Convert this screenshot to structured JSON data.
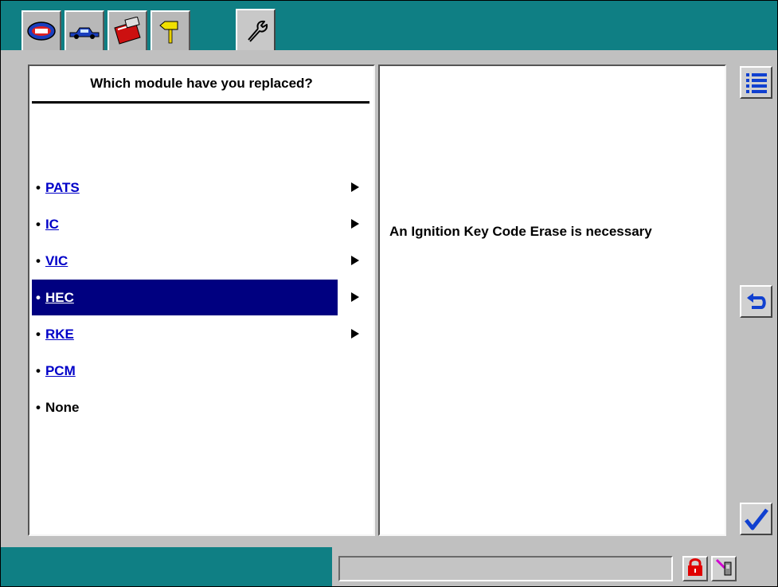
{
  "toolbar": {
    "tabs": [
      {
        "icon": "ids-logo-icon",
        "active": false
      },
      {
        "icon": "vehicle-icon",
        "active": false
      },
      {
        "icon": "toolbox-icon",
        "active": false
      },
      {
        "icon": "signpost-icon",
        "active": false
      },
      {
        "icon": "wrench-icon",
        "active": true
      }
    ]
  },
  "question": {
    "title": "Which module have you replaced?"
  },
  "options": [
    {
      "bullet": "•",
      "label": "PATS",
      "link": true,
      "has_arrow": true,
      "selected": false
    },
    {
      "bullet": "•",
      "label": "IC",
      "link": true,
      "has_arrow": true,
      "selected": false
    },
    {
      "bullet": "•",
      "label": "VIC",
      "link": true,
      "has_arrow": true,
      "selected": false
    },
    {
      "bullet": "•",
      "label": "HEC",
      "link": true,
      "has_arrow": true,
      "selected": true
    },
    {
      "bullet": "•",
      "label": "RKE",
      "link": true,
      "has_arrow": true,
      "selected": false
    },
    {
      "bullet": "•",
      "label": "PCM",
      "link": true,
      "has_arrow": false,
      "selected": false
    },
    {
      "bullet": "•",
      "label": "None",
      "link": false,
      "has_arrow": false,
      "selected": false
    }
  ],
  "info": {
    "message": "An Ignition Key Code Erase is necessary"
  },
  "side_buttons": [
    {
      "icon": "list-icon"
    },
    {
      "icon": "return-icon"
    },
    {
      "icon": "checkmark-icon"
    }
  ],
  "status": {
    "text": "",
    "icons": [
      "padlock-icon",
      "communication-icon"
    ]
  },
  "colors": {
    "frame": "#0f7f84",
    "workspace": "#c0c0c0",
    "selection": "#000080",
    "link": "#0000c8"
  }
}
